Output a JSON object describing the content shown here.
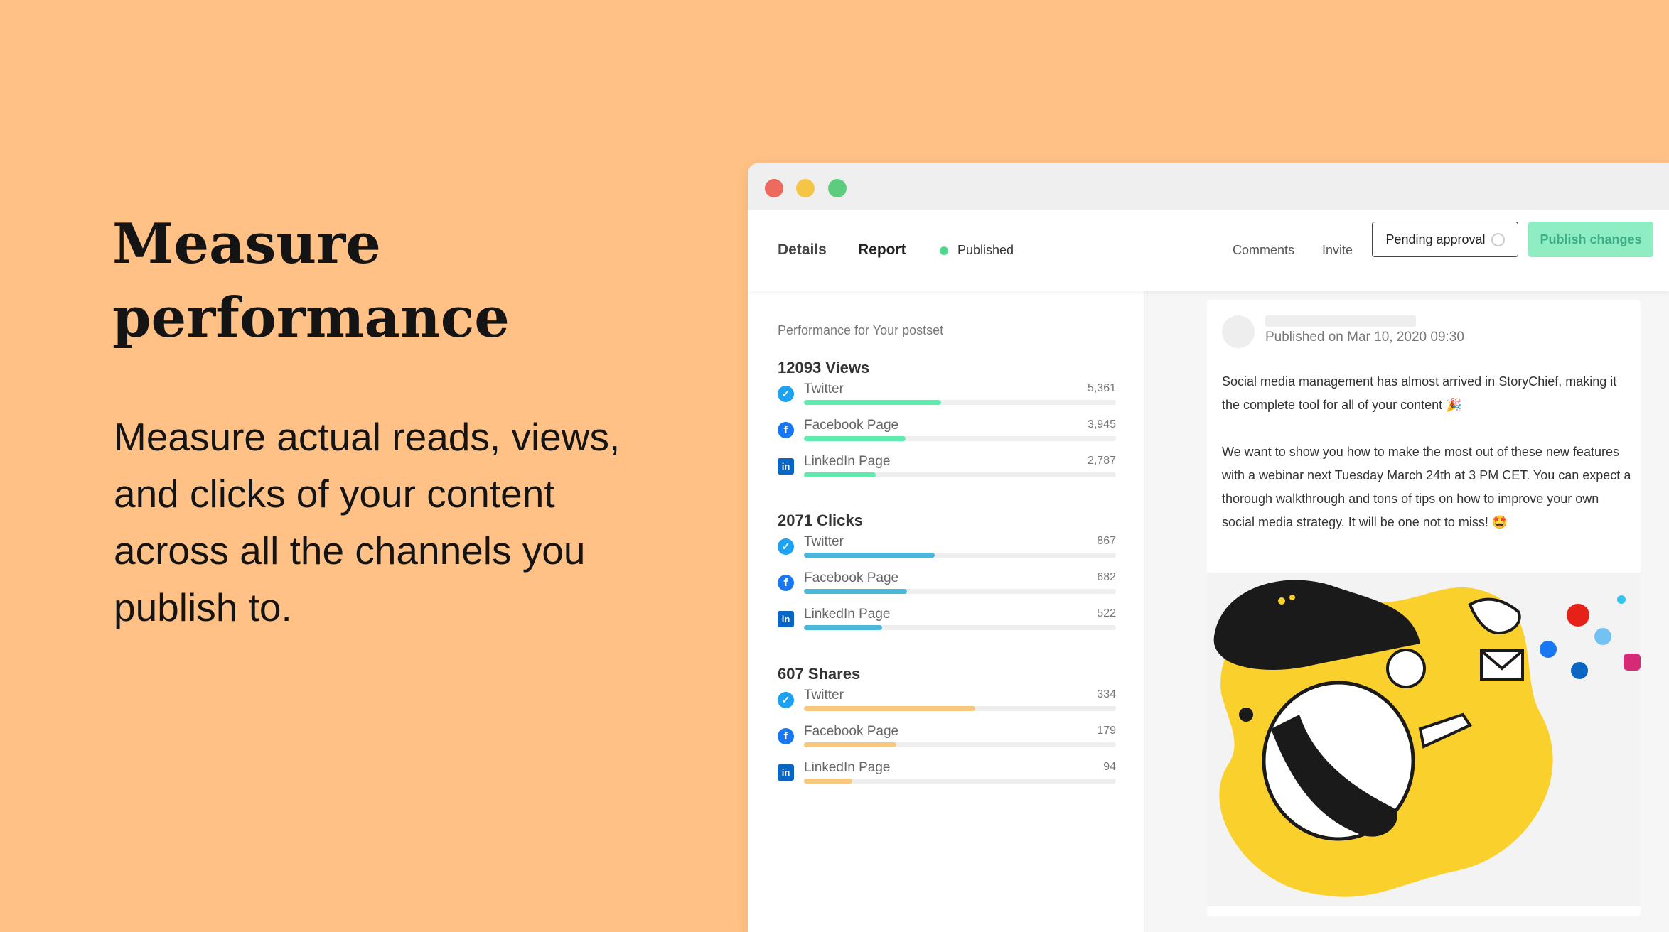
{
  "hero": {
    "title_line1": "Measure",
    "title_line2": "performance",
    "description": "Measure actual reads, views, and clicks of your content across all the channels you publish to."
  },
  "window": {
    "tabs": {
      "details": "Details",
      "report": "Report"
    },
    "status": "Published",
    "nav": {
      "comments": "Comments",
      "invite": "Invite"
    },
    "pending_approval": "Pending approval",
    "publish_changes": "Publish changes"
  },
  "report": {
    "performance_label": "Performance for Your postset",
    "metrics": [
      {
        "title": "12093 Views",
        "color": "#5EEBAE",
        "rows": [
          {
            "icon": "twitter-icon",
            "label": "Twitter",
            "value": "5,361",
            "fraction": 0.44
          },
          {
            "icon": "facebook-icon",
            "label": "Facebook Page",
            "value": "3,945",
            "fraction": 0.325
          },
          {
            "icon": "linkedin-icon",
            "label": "LinkedIn Page",
            "value": "2,787",
            "fraction": 0.23
          }
        ]
      },
      {
        "title": "2071 Clicks",
        "color": "#4BB8D9",
        "rows": [
          {
            "icon": "twitter-icon",
            "label": "Twitter",
            "value": "867",
            "fraction": 0.42
          },
          {
            "icon": "facebook-icon",
            "label": "Facebook Page",
            "value": "682",
            "fraction": 0.33
          },
          {
            "icon": "linkedin-icon",
            "label": "LinkedIn Page",
            "value": "522",
            "fraction": 0.25
          }
        ]
      },
      {
        "title": "607 Shares",
        "color": "#F8C77E",
        "rows": [
          {
            "icon": "twitter-icon",
            "label": "Twitter",
            "value": "334",
            "fraction": 0.55
          },
          {
            "icon": "facebook-icon",
            "label": "Facebook Page",
            "value": "179",
            "fraction": 0.295
          },
          {
            "icon": "linkedin-icon",
            "label": "LinkedIn Page",
            "value": "94",
            "fraction": 0.155
          }
        ]
      }
    ]
  },
  "post": {
    "published_on": "Published on Mar 10, 2020 09:30",
    "paragraph1": "Social media management has almost arrived in StoryChief, making it the complete tool for all of your content 🎉",
    "paragraph2": "We want to show you how to make the most out of these new features with a webinar next Tuesday March 24th at 3 PM CET. You can expect a thorough walkthrough and tons of tips on how to improve your own social media strategy. It will be one not to miss! 🤩"
  },
  "colors": {
    "background": "#FFC185",
    "published_dot": "#4ED98F",
    "publish_button": "#8FEDC4"
  }
}
